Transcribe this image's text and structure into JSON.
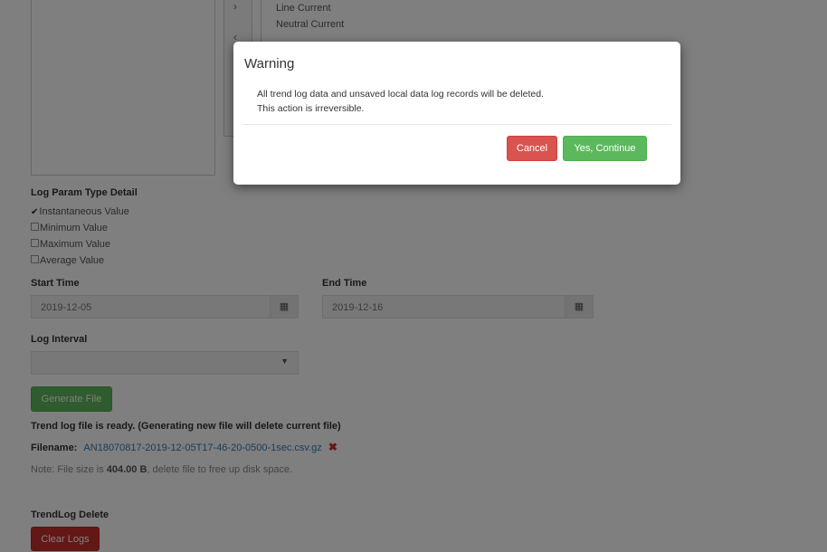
{
  "selected_params": [
    "Line Current",
    "Neutral Current"
  ],
  "log_param": {
    "heading": "Log Param Type Detail",
    "options": [
      {
        "label": "Instantaneous Value",
        "checked": true
      },
      {
        "label": "Minimum Value",
        "checked": false
      },
      {
        "label": "Maximum Value",
        "checked": false
      },
      {
        "label": "Average Value",
        "checked": false
      }
    ]
  },
  "start_time": {
    "label": "Start Time",
    "value": "2019-12-05",
    "icon": "calendar-icon"
  },
  "end_time": {
    "label": "End Time",
    "value": "2019-12-16",
    "icon": "calendar-icon"
  },
  "log_interval": {
    "label": "Log Interval",
    "value": ""
  },
  "generate_button": "Generate File",
  "file_info": {
    "ready_text": "Trend log file is ready. (Generating new file will delete current file)",
    "filename_label": "Filename:",
    "filename": "AN18070817-2019-12-05T17-46-20-0500-1sec.csv.gz",
    "delete_glyph": "✖",
    "note_prefix": "Note: File size is ",
    "file_size": "404.00 B",
    "note_suffix": ", delete file to free up disk space."
  },
  "trendlog_delete": {
    "heading": "TrendLog Delete",
    "button": "Clear Logs"
  },
  "modal": {
    "title": "Warning",
    "line1": "All trend log data and unsaved local data log records will be deleted.",
    "line2": "This action is irreversible.",
    "cancel": "Cancel",
    "continue": "Yes, Continue"
  },
  "colors": {
    "success": "#5cb85c",
    "danger": "#d9534f",
    "link": "#337ab7"
  }
}
